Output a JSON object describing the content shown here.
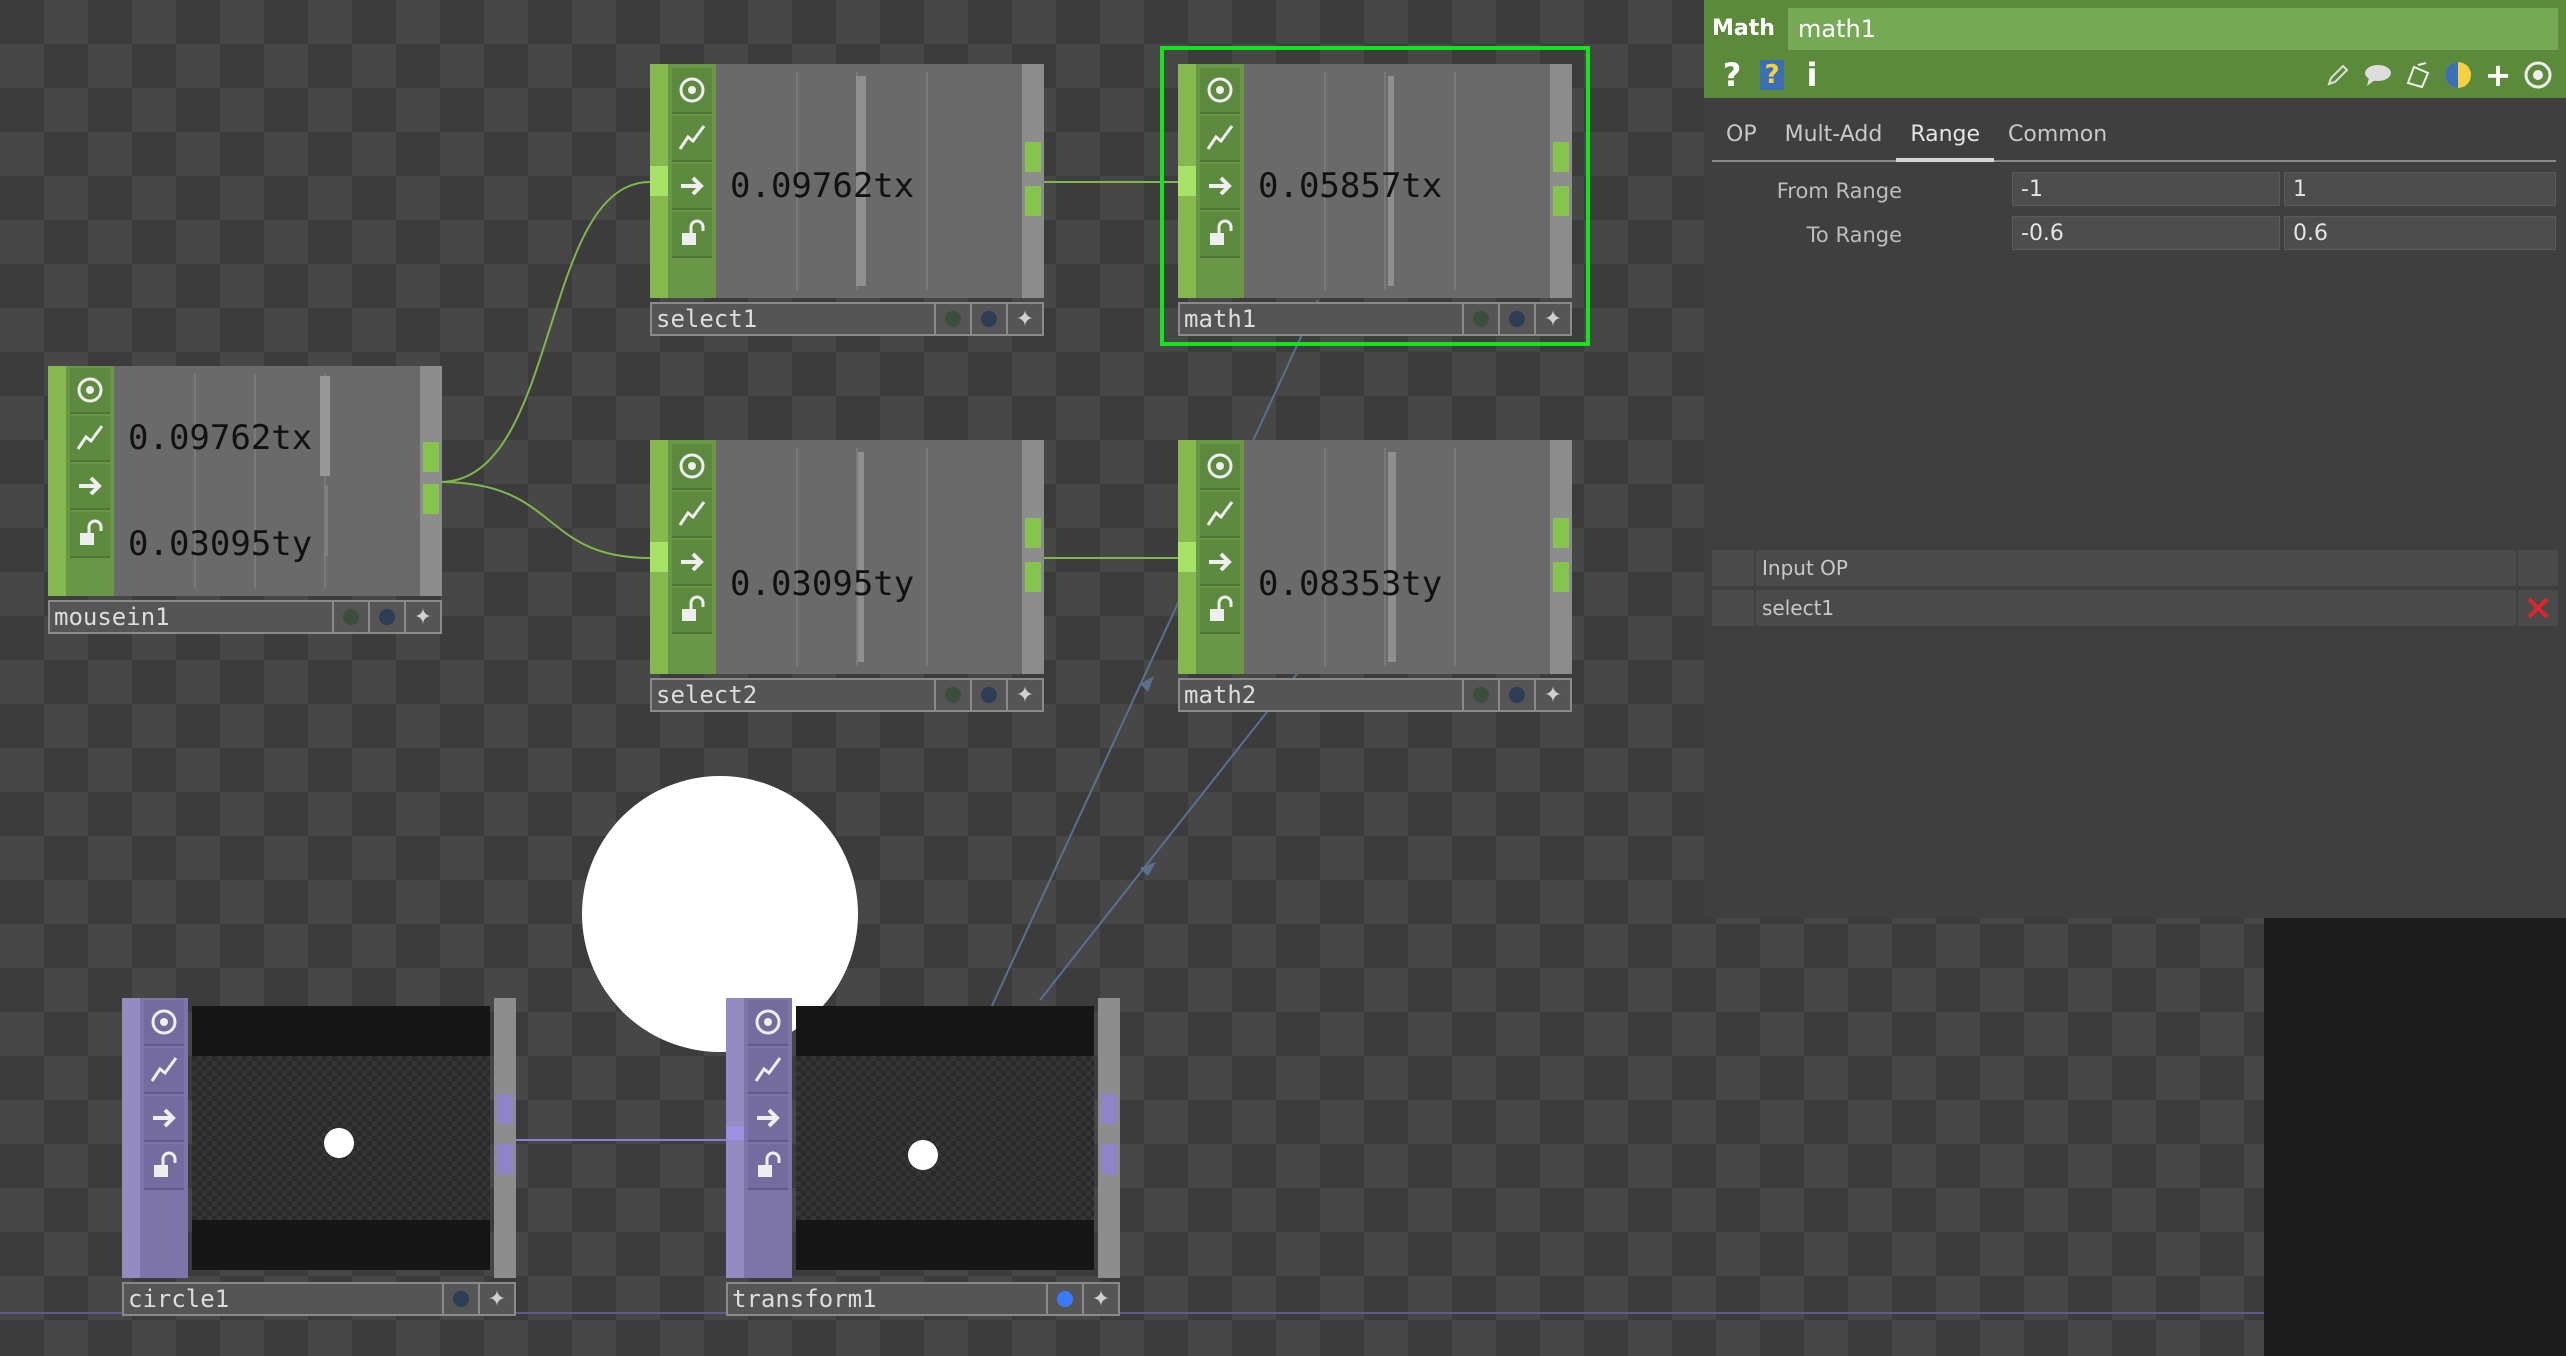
{
  "nodes": {
    "mousein1": {
      "name": "mousein1",
      "values": [
        "0.09762tx",
        "0.03095ty"
      ]
    },
    "select1": {
      "name": "select1",
      "values": [
        "0.09762tx"
      ]
    },
    "select2": {
      "name": "select2",
      "values": [
        "0.03095ty"
      ]
    },
    "math1": {
      "name": "math1",
      "values": [
        "0.05857tx"
      ]
    },
    "math2": {
      "name": "math2",
      "values": [
        "0.08353ty"
      ]
    },
    "circle1": {
      "name": "circle1"
    },
    "transform1": {
      "name": "transform1"
    }
  },
  "param_panel": {
    "op_type": "Math",
    "op_name": "math1",
    "tabs": [
      "OP",
      "Mult-Add",
      "Range",
      "Common"
    ],
    "active_tab": "Range",
    "params": [
      {
        "label": "From Range",
        "v1": "-1",
        "v2": "1"
      },
      {
        "label": "To Range",
        "v1": "-0.6",
        "v2": "0.6"
      }
    ],
    "input_table": {
      "header": "Input OP",
      "rows": [
        "select1"
      ]
    }
  },
  "colors": {
    "chop": "#6a9648",
    "top": "#7d74a8",
    "selection": "#15e31d",
    "panel_header": "#5c8a3b"
  },
  "icons": [
    "viewer-icon",
    "pulse-icon",
    "bypass-arrow-icon",
    "lock-icon",
    "help-icon",
    "python-help-icon",
    "info-icon",
    "edit-icon",
    "comment-icon",
    "clone-icon",
    "python-icon",
    "add-icon",
    "target-icon",
    "delete-icon"
  ]
}
